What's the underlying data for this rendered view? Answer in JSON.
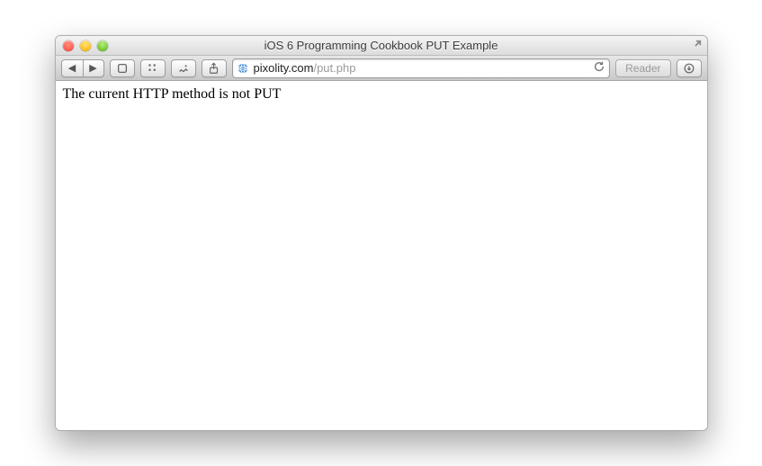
{
  "window_title": "iOS 6 Programming Cookbook PUT Example",
  "toolbar": {
    "reader_label": "Reader"
  },
  "address": {
    "domain": "pixolity.com",
    "path": "/put.php"
  },
  "page": {
    "body_text": "The current HTTP method is not PUT"
  }
}
